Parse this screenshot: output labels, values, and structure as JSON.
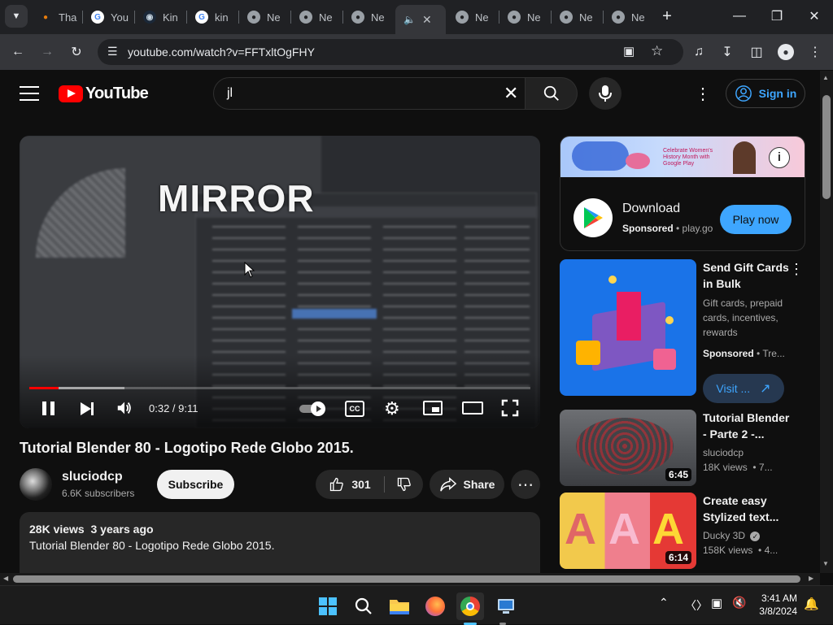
{
  "browser": {
    "tabs": [
      {
        "label": "Tha",
        "icon": "blender-icon"
      },
      {
        "label": "You",
        "icon": "google-icon"
      },
      {
        "label": "Kin",
        "icon": "steam-icon"
      },
      {
        "label": "kin",
        "icon": "google-icon"
      },
      {
        "label": "Ne",
        "icon": "chrome-icon"
      },
      {
        "label": "Ne",
        "icon": "chrome-icon"
      },
      {
        "label": "Ne",
        "icon": "chrome-icon"
      },
      {
        "label": "Ne",
        "icon": "chrome-icon"
      },
      {
        "label": "Ne",
        "icon": "chrome-icon"
      },
      {
        "label": "Ne",
        "icon": "chrome-icon"
      },
      {
        "label": "Ne",
        "icon": "chrome-icon"
      }
    ],
    "url": "youtube.com/watch?v=FFTxltOgFHY",
    "new_tab_glyph": "+"
  },
  "youtube": {
    "logo_text": "YouTube",
    "search_value": "jl",
    "sign_in": "Sign in"
  },
  "video": {
    "overlay_text": "MIRROR",
    "time": "0:32 / 9:11",
    "progress": 0.058,
    "buffered": 0.19,
    "title": "Tutorial Blender 80 - Logotipo Rede Globo 2015.",
    "channel": "sluciodcp",
    "subscribers": "6.6K subscribers",
    "subscribe": "Subscribe",
    "likes": "301",
    "share": "Share",
    "views": "28K views",
    "age": "3 years ago",
    "description": "Tutorial Blender 80 - Logotipo Rede Globo 2015."
  },
  "ad": {
    "banner_text": "Celebrate Women's History Month with Google Play",
    "title": "Download",
    "sponsored": "Sponsored",
    "domain": "play.go",
    "cta": "Play now"
  },
  "sidebar": [
    {
      "title1": "Send Gift Cards",
      "title2": "in Bulk",
      "desc1": "Gift cards, prepaid",
      "desc2": "cards, incentives,",
      "desc3": "rewards",
      "sponsored": "Sponsored",
      "source": "Tre...",
      "cta": "Visit ..."
    },
    {
      "title1": "Tutorial Blender",
      "title2": "- Parte 2 -...",
      "channel": "sluciodcp",
      "meta": "18K views  • 7...",
      "duration": "6:45"
    },
    {
      "title1": "Create easy",
      "title2": "Stylized text...",
      "channel": "Ducky 3D",
      "meta": "158K views  • 4...",
      "duration": "6:14"
    }
  ],
  "taskbar": {
    "time": "3:41 AM",
    "date": "3/8/2024"
  },
  "colors": {
    "yt_red": "#ff0000",
    "link_blue": "#3ea6ff",
    "play_blue": "#1a73e8",
    "progress_red": "#ff0000"
  }
}
